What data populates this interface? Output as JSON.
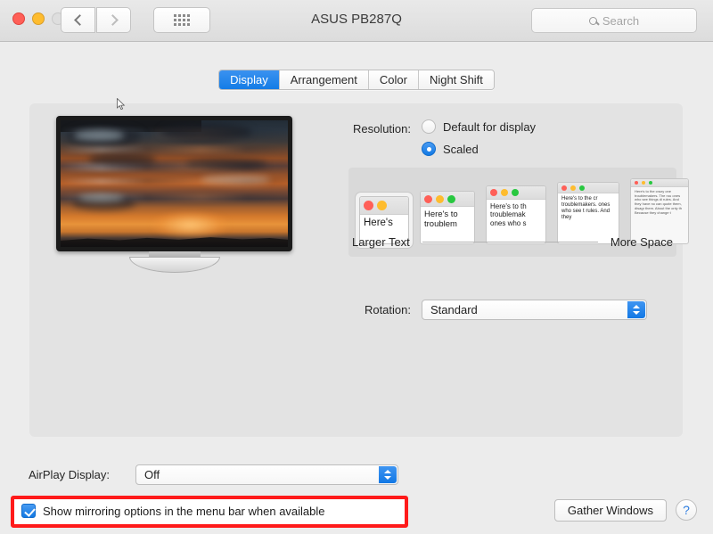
{
  "window": {
    "title": "ASUS PB287Q",
    "traffic_lights": [
      "close",
      "minimize",
      "zoom-disabled"
    ],
    "nav": {
      "back_icon": "chevron-left-icon",
      "forward_icon": "chevron-right-icon",
      "grid_icon": "show-all-grid-icon"
    },
    "search": {
      "placeholder": "Search",
      "value": "",
      "icon": "search-icon"
    }
  },
  "tabs": [
    {
      "label": "Display",
      "active": true
    },
    {
      "label": "Arrangement",
      "active": false
    },
    {
      "label": "Color",
      "active": false
    },
    {
      "label": "Night Shift",
      "active": false
    }
  ],
  "display_preview": {
    "name": "monitor-preview",
    "wallpaper": "sunset-clouds"
  },
  "resolution": {
    "label": "Resolution:",
    "options": [
      {
        "label": "Default for display",
        "selected": false
      },
      {
        "label": "Scaled",
        "selected": true
      }
    ]
  },
  "scaling": {
    "left_label": "Larger Text",
    "right_label": "More Space",
    "thumbnails": [
      {
        "selected": true,
        "dots": [
          "red",
          "yellow"
        ],
        "text": "Here's"
      },
      {
        "selected": false,
        "dots": [
          "red",
          "yellow",
          "green"
        ],
        "text": "Here's to troublem"
      },
      {
        "selected": false,
        "dots": [
          "red",
          "yellow",
          "green"
        ],
        "text": "Here's to th troublemak ones who s"
      },
      {
        "selected": false,
        "dots": [
          "red",
          "yellow",
          "green"
        ],
        "text": "Here's to the cr troublemakers. ones who see t rules. And they"
      },
      {
        "selected": false,
        "dots": [
          "red",
          "yellow",
          "green"
        ],
        "text": "Here's to the crazy one troublemakers. The rou ones who see things di rules. And they have no can quote them, disagr them. About the only th Because they change t"
      }
    ]
  },
  "rotation": {
    "label": "Rotation:",
    "value": "Standard"
  },
  "airplay": {
    "label": "AirPlay Display:",
    "value": "Off"
  },
  "mirroring": {
    "label": "Show mirroring options in the menu bar when available",
    "checked": true
  },
  "buttons": {
    "gather_windows": "Gather Windows",
    "help": "?"
  },
  "annotation": {
    "type": "red-highlight-rectangle",
    "color": "#ff1a1a"
  }
}
